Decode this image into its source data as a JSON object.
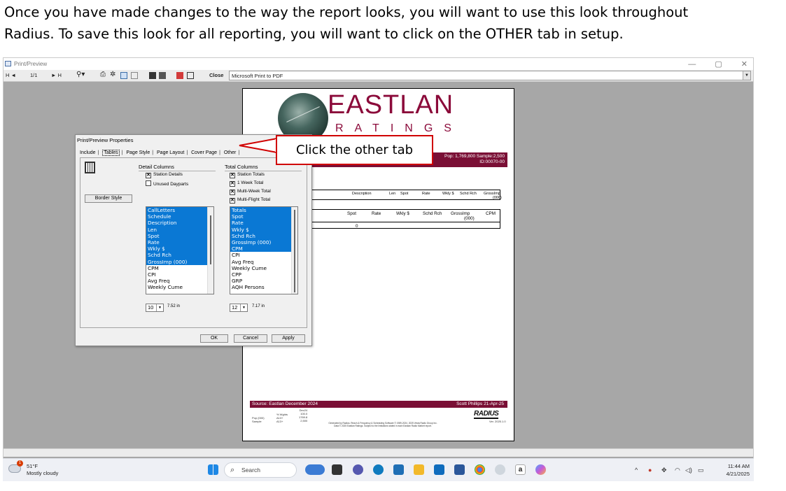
{
  "intro": {
    "line1": "Once you have made changes to the way the report looks, you will want to use this look throughout",
    "line2": "Radius.  To save this look for all reporting, you will want to click on the OTHER tab in setup."
  },
  "window": {
    "title": "Print/Preview",
    "toolbar": {
      "first": "H ◄",
      "page_counter": "1/1",
      "next_last": "► H",
      "close_label": "Close",
      "printer": "Microsoft Print to PDF"
    }
  },
  "report": {
    "brand_name": "EASTLAN",
    "brand_sub": "RATINGS",
    "header_line1": "Pop: 1,769,800  Sample:2,500",
    "header_line2": "ID:00070-00",
    "table1_columns": [
      "Description",
      "Len",
      "Spot",
      "Rate",
      "Wkly $",
      "Schd Rch",
      "GrossImp",
      "(000)"
    ],
    "table2_columns": [
      "Spot",
      "Rate",
      "Wkly $",
      "Schd Rch",
      "GrossImp",
      "CPM"
    ],
    "table2_subheader": "(000)",
    "table2_value": "0",
    "footer_left": "Source: Eastlan December 2024",
    "footer_right": "Scott Phillips    21-Apr-25",
    "logo": "RADIUS",
    "logo_version": "Ver. 2025.1.0",
    "fine_labels": [
      "% Wghts",
      "Pop (000)",
      "Sample"
    ],
    "fine_demo": [
      "A13+",
      "A13+",
      "A13+"
    ],
    "fine_values": [
      "Dec24",
      "100.0",
      "1769.8",
      "2,500"
    ],
    "fine_credits": "Generated by Radius, Reach & Frequency & Scheduling Software © 1989-2024. 2025 Vesta Radio Group Inc.",
    "fine_credits2": "Data © 2025 Eastlan Ratings. Subject to the limitations stated in each Eastlan Radio Market report."
  },
  "dialog": {
    "title": "Print/Preview Properties",
    "close": "×",
    "tabs": [
      "Include",
      "Tables",
      "Page Style",
      "Page Layout",
      "Cover Page",
      "Other"
    ],
    "selected_tab": "Tables",
    "border_style_label": "Border Style",
    "detail": {
      "heading": "Detail Columns",
      "checks": [
        {
          "label": "Station Details",
          "checked": true
        },
        {
          "label": "Unused Dayparts",
          "checked": false
        }
      ],
      "items": [
        {
          "label": "CallLetters",
          "sel": true
        },
        {
          "label": "Schedule",
          "sel": true
        },
        {
          "label": "Description",
          "sel": true
        },
        {
          "label": "Len",
          "sel": true
        },
        {
          "label": "Spot",
          "sel": true
        },
        {
          "label": "Rate",
          "sel": true
        },
        {
          "label": "Wkly $",
          "sel": true
        },
        {
          "label": "Schd Rch",
          "sel": true
        },
        {
          "label": "GrossImp (000)",
          "sel": true
        },
        {
          "label": "CPM",
          "sel": false
        },
        {
          "label": "CPI",
          "sel": false
        },
        {
          "label": "Avg Freq",
          "sel": false
        },
        {
          "label": "Weekly Cume",
          "sel": false
        }
      ],
      "font_size": "10",
      "width": "7.52 in"
    },
    "total": {
      "heading": "Total Columns",
      "checks": [
        {
          "label": "Station Totals",
          "checked": true
        },
        {
          "label": "1 Week Total",
          "checked": true
        },
        {
          "label": "Multi-Week Total",
          "checked": true
        },
        {
          "label": "Multi-Flight Total",
          "checked": true
        }
      ],
      "items": [
        {
          "label": "Totals",
          "sel": true
        },
        {
          "label": "Spot",
          "sel": true
        },
        {
          "label": "Rate",
          "sel": true
        },
        {
          "label": "Wkly $",
          "sel": true
        },
        {
          "label": "Schd Rch",
          "sel": true
        },
        {
          "label": "GrossImp (000)",
          "sel": true
        },
        {
          "label": "CPM",
          "sel": true
        },
        {
          "label": "CPI",
          "sel": false
        },
        {
          "label": "Avg Freq",
          "sel": false
        },
        {
          "label": "Weekly Cume",
          "sel": false
        },
        {
          "label": "CPP",
          "sel": false
        },
        {
          "label": "GRP",
          "sel": false
        },
        {
          "label": "AQH Persons",
          "sel": false
        }
      ],
      "font_size": "12",
      "width": "7.17 in"
    },
    "buttons": {
      "ok": "OK",
      "cancel": "Cancel",
      "apply": "Apply"
    }
  },
  "callout": {
    "text": "Click the other tab",
    "color": "#d00000"
  },
  "taskbar": {
    "weather_badge": "1",
    "temperature": "51°F",
    "weather_text": "Mostly cloudy",
    "search_placeholder": "Search",
    "time": "11:44 AM",
    "date": "4/21/2025"
  },
  "colors": {
    "brand": "#8b0a3a",
    "selection": "#0a78d4",
    "background": "#a7a7a7"
  }
}
